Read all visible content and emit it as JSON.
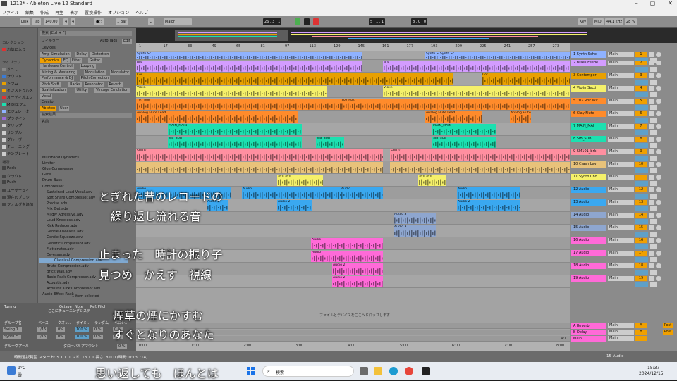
{
  "window": {
    "title": "1212* - Ableton Live 12 Standard"
  },
  "menu": [
    "ファイル",
    "編集",
    "作成",
    "再生",
    "表示",
    "置換操作",
    "オプション",
    "ヘルプ"
  ],
  "transport": {
    "link": "Link",
    "tap": "Tap",
    "tempo": "140.00",
    "sig_num": "4",
    "sig_den": "4",
    "metro": "●○",
    "quant": "1 Bar",
    "key": "C",
    "scale": "Major",
    "position": "26 .  3 .  1",
    "loop_start": "5 .  1 .  1",
    "loop_len": "8 .  0 .  0",
    "key_btn": "Key",
    "midi_btn": "MIDI",
    "sample_rate": "44.1 kHz",
    "cpu": "28 %"
  },
  "browser": {
    "collections_header": "コレクション",
    "favorites": "お気に入り",
    "search_placeholder": "検索 (Ctrl + F)",
    "library_header": "ライブラリ",
    "library_items": [
      "すべて",
      "サウンド",
      "ドラム",
      "インストゥルメ",
      "オーディオエフ",
      "MIDIエフェ",
      "モジュレーター",
      "プラグイン",
      "クリップ",
      "サンプル",
      "グルーヴ",
      "チューニング",
      "テンプレート"
    ],
    "places_header": "場所",
    "places_items": [
      "Pack",
      "クラウド",
      "Push",
      "ユーザーライ",
      "現在のプロジ",
      "フォルダを追加"
    ],
    "filter_label": "フィルター",
    "auto_tags": "Auto Tags",
    "edit": "Edit",
    "devices_label": "Devices",
    "chips_row1": [
      "Amp Simulation",
      "Delay",
      "Distortion"
    ],
    "chips_row2": [
      "Dynamics",
      "EQ",
      "Filter",
      "Guitar"
    ],
    "chips_row3": [
      "Hardware Control",
      "Looping"
    ],
    "chips_row4": [
      "Mixing & Mastering",
      "Modulation",
      "Modulator"
    ],
    "chips_row5": [
      "Performance & DJ",
      "Pitch Correction"
    ],
    "chips_row6": [
      "Pitch Shift",
      "Racks",
      "Resonator",
      "Reverb"
    ],
    "chips_row7": [
      "Spatialization",
      "Utility",
      "Vintage Emulation"
    ],
    "chips_row8": [
      "Vocal"
    ],
    "creator_label": "Creator",
    "creator_chips": [
      "Ableton",
      "User"
    ],
    "results_label": "検索結果",
    "name_col": "名前",
    "files": [
      "Multiband Dynamics",
      "Limiter",
      "Glue Compressor",
      "Gate",
      "Drum Buss",
      "Compressor",
      "Sustained Lead Vocal.adv",
      "Soft Snare Compressor.adv",
      "Precise.adv",
      "Mix Get.adv",
      "Mildly Agressive.adv",
      "Loud-Kneeless.adv",
      "Kick Reducer.adv",
      "Gentle-Kneeless.adv",
      "Gentle Squeeze.adv",
      "Generic Compressor.adv",
      "Flattenator.adv",
      "De-esser.adv",
      "Classical Compression.adv",
      "Brute Compression.adv",
      "Brick Wall.adv",
      "Basic Peak Compressor.adv",
      "Acoustic.adv",
      "Acoustic Kick Compressor.adv",
      "Audio Effect Rack"
    ],
    "selected_index": 18,
    "footer": "1 item selected"
  },
  "lower_left": {
    "tuning": "Tuning",
    "headers": [
      "Octave",
      "Note",
      "Ref. Pitch"
    ],
    "placeholder": "ここにチューニングシステ",
    "groove_header": [
      "グループ名",
      "ベース",
      "クオン..",
      "タイミ..",
      "ランダム",
      "ベロシ.."
    ],
    "grooves": [
      {
        "name": "Swing 1..",
        "base": "1/16",
        "q": "0%",
        "t": "100 %",
        "r": "0 %",
        "v": "0 %"
      },
      {
        "name": "Synth E..",
        "base": "1/16",
        "q": "0%",
        "t": "100 %",
        "r": "0 %",
        "v": "0 %"
      }
    ],
    "pool": "グルーヴプール",
    "global_amount": "グローバルアマウント",
    "global_value": "0 %"
  },
  "ruler": [
    "1",
    "17",
    "33",
    "49",
    "65",
    "81",
    "97",
    "113",
    "129",
    "145",
    "161",
    "177",
    "193",
    "209",
    "225",
    "241",
    "257",
    "273"
  ],
  "time_ruler": [
    "0:00",
    "1:00",
    "2:00",
    "3:00",
    "4:00",
    "5:00",
    "6:00",
    "7:00",
    "8:00"
  ],
  "drop_hint": "ファイルとデバイスをここへドロップします",
  "tracks": [
    {
      "name": "1 Synth Sche",
      "color": "#8fb2ff",
      "num": "1",
      "clip": "Synth Sc"
    },
    {
      "name": "2 Brass Feede",
      "color": "#d39cff",
      "num": "2",
      "clip": "Brs"
    },
    {
      "name": "3 Contempor",
      "color": "#e8a000",
      "num": "3",
      "clip": "Cor"
    },
    {
      "name": "4 Violin Secti",
      "color": "#f5f06a",
      "num": "4",
      "clip": "Violin"
    },
    {
      "name": "5 707 Rok Wit",
      "color": "#ff8b2b",
      "num": "5",
      "clip": "707 Rok"
    },
    {
      "name": "6 Clay Flute",
      "color": "#ff8b2b",
      "num": "6",
      "clip": "Analog Flute Lead"
    },
    {
      "name": "7 MAIN_MAI",
      "color": "#1ce0b0",
      "num": "7",
      "clip": "MAIN_MAIN"
    },
    {
      "name": "8 SIB_SUB",
      "color": "#1ce0b0",
      "num": "8",
      "clip": "SIB_SUB"
    },
    {
      "name": "9 SM101_brk",
      "color": "#ff8fa0",
      "num": "9",
      "clip": "SM101"
    },
    {
      "name": "10 Crash Lay",
      "color": "#e8c27a",
      "num": "10",
      "clip": ""
    },
    {
      "name": "11 Synth Cho",
      "color": "#f5f06a",
      "num": "11",
      "clip": "Syn Syn"
    },
    {
      "name": "12 Audio",
      "color": "#3aa8f0",
      "num": "12",
      "clip": "Audio"
    },
    {
      "name": "13 Audio",
      "color": "#3aa8f0",
      "num": "13",
      "clip": "Audio 2"
    },
    {
      "name": "14 Audio",
      "color": "#8ea6cf",
      "num": "14",
      "clip": "Audio 3"
    },
    {
      "name": "15 Audio",
      "color": "#8ea6cf",
      "num": "15",
      "clip": "Audio 3"
    },
    {
      "name": "16 Audio",
      "color": "#ff6ad8",
      "num": "16",
      "clip": "Audio"
    },
    {
      "name": "17 Audio",
      "color": "#ff6ad8",
      "num": "17",
      "clip": "Audio"
    },
    {
      "name": "18 Audio",
      "color": "#ff6ad8",
      "num": "18",
      "clip": "Audio 2"
    },
    {
      "name": "19 Audio",
      "color": "#ff6ad8",
      "num": "19",
      "clip": "Audio 2"
    }
  ],
  "returns": [
    {
      "name": "A Reverb",
      "letter": "A",
      "color": "#ff6ad8"
    },
    {
      "name": "B Delay",
      "letter": "B",
      "color": "#ff6ad8"
    },
    {
      "name": "Main",
      "letter": "",
      "color": "#ff6ad8"
    }
  ],
  "io_label": "Main",
  "post_label": "Post",
  "page_label": "4/1",
  "status": {
    "left": "時間選択範囲 スタート: 5.1.1 エンド: 13.1.1 長さ: 8.0.0 (時間: 0:13.714)",
    "right": "15-Audio"
  },
  "lyrics": [
    "とぎれた昔のレコードの",
    "繰り返し流れる音",
    "止まった　時計の振り子",
    "見つめ　かえす　視線",
    "煙草の煙にかすむ",
    "すぐとなりのあなた",
    "思い返しても　ほんとは"
  ],
  "taskbar": {
    "weather_temp": "9°C",
    "weather_text": "曇",
    "search": "検索",
    "time": "15:37",
    "date": "2024/12/15"
  }
}
